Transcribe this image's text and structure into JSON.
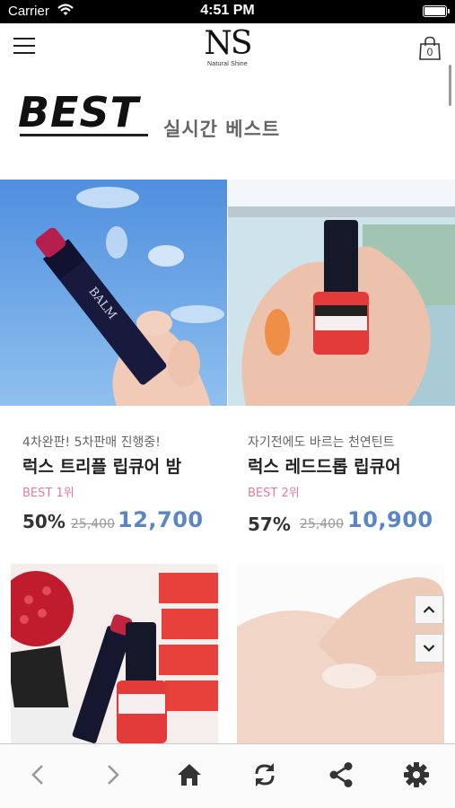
{
  "status_bar": {
    "carrier": "Carrier",
    "time": "4:51 PM"
  },
  "header": {
    "logo_text": "NS",
    "logo_subtext": "Natural Shine",
    "cart_count": "0"
  },
  "section": {
    "title": "BEST",
    "subtitle": "실시간 베스트"
  },
  "products": [
    {
      "tagline": "4차완판! 5차판매 진행중!",
      "name": "럭스 트리플 립큐어 밤",
      "rank": "BEST 1위",
      "discount": "50%",
      "original_price": "25,400",
      "price": "12,700"
    },
    {
      "tagline": "자기전에도 바르는 천연틴트",
      "name": "럭스 레드드롭 립큐어",
      "rank": "BEST 2위",
      "discount": "57%",
      "original_price": "25,400",
      "price": "10,900"
    }
  ],
  "icons": {
    "menu": "hamburger-icon",
    "cart": "shopping-bag-icon",
    "scroll_up": "chevron-up-icon",
    "scroll_down": "chevron-down-icon",
    "back": "chevron-left-icon",
    "forward": "chevron-right-icon",
    "home": "home-icon",
    "refresh": "refresh-icon",
    "share": "share-icon",
    "settings": "gear-icon"
  },
  "colors": {
    "price_blue": "#5b86c5",
    "rank_pink": "#e9799a",
    "toolbar_bg": "#fafafa"
  }
}
